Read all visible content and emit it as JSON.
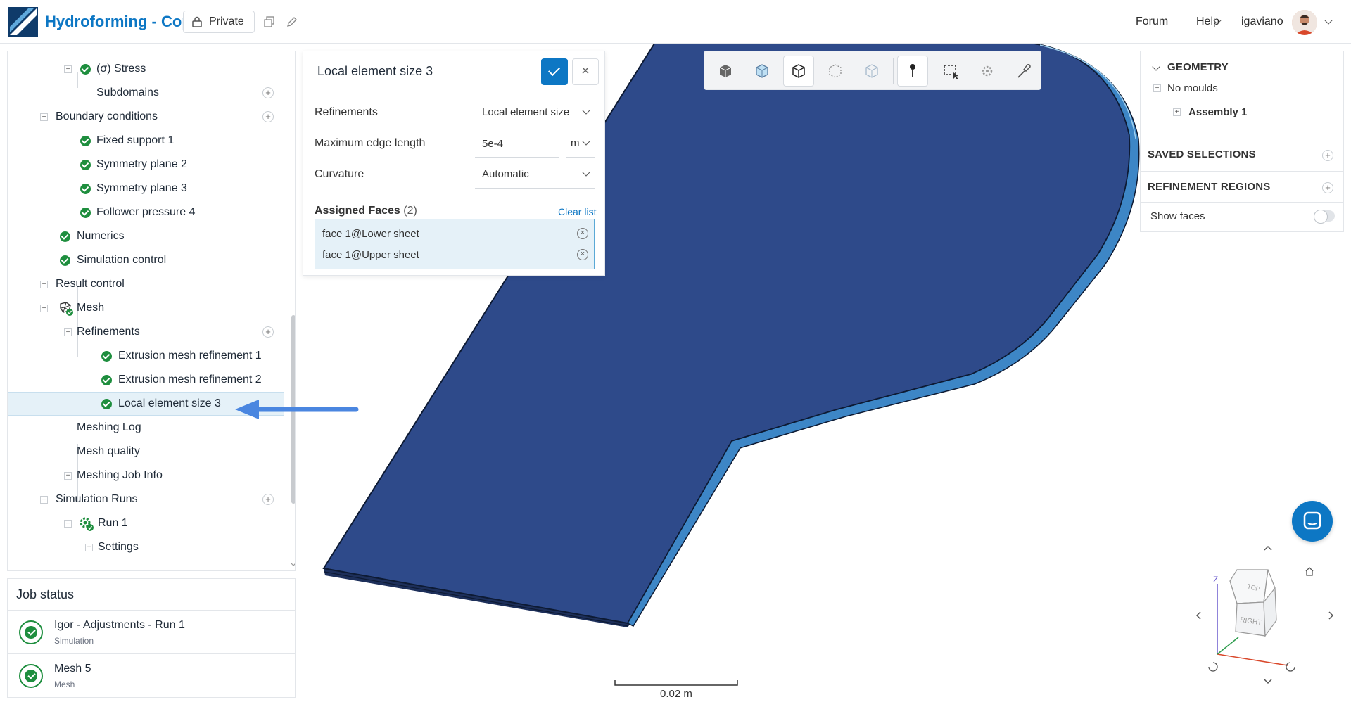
{
  "header": {
    "title": "Hydroforming - Copy",
    "private_label": "Private",
    "forum_label": "Forum",
    "help_label": "Help",
    "username": "igaviano"
  },
  "tree": {
    "items": [
      {
        "label": "(σ) Stress"
      },
      {
        "label": "Subdomains"
      },
      {
        "label": "Boundary conditions"
      },
      {
        "label": "Fixed support 1"
      },
      {
        "label": "Symmetry plane 2"
      },
      {
        "label": "Symmetry plane 3"
      },
      {
        "label": "Follower pressure 4"
      },
      {
        "label": "Numerics"
      },
      {
        "label": "Simulation control"
      },
      {
        "label": "Result control"
      },
      {
        "label": "Mesh"
      },
      {
        "label": "Refinements"
      },
      {
        "label": "Extrusion mesh refinement 1"
      },
      {
        "label": "Extrusion mesh refinement 2"
      },
      {
        "label": "Local element size 3"
      },
      {
        "label": "Meshing Log"
      },
      {
        "label": "Mesh quality"
      },
      {
        "label": "Meshing Job Info"
      },
      {
        "label": "Simulation Runs"
      },
      {
        "label": "Run 1"
      },
      {
        "label": "Settings"
      }
    ]
  },
  "job_status": {
    "title": "Job status",
    "jobs": [
      {
        "name": "Igor - Adjustments - Run 1",
        "type": "Simulation"
      },
      {
        "name": "Mesh 5",
        "type": "Mesh"
      }
    ]
  },
  "dialog": {
    "title": "Local element size 3",
    "refinements_label": "Refinements",
    "refinements_value": "Local element size",
    "max_edge_label": "Maximum edge length",
    "max_edge_value": "5e-4",
    "max_edge_unit": "m",
    "curvature_label": "Curvature",
    "curvature_value": "Automatic",
    "assigned_label": "Assigned Faces",
    "assigned_count": "(2)",
    "clear_label": "Clear list",
    "faces": [
      "face 1@Lower sheet",
      "face 1@Upper sheet"
    ]
  },
  "right_panel": {
    "geometry_label": "GEOMETRY",
    "no_moulds_label": "No moulds",
    "assembly_label": "Assembly 1",
    "saved_selections_label": "SAVED SELECTIONS",
    "refinement_regions_label": "REFINEMENT REGIONS",
    "show_faces_label": "Show faces"
  },
  "viewport": {
    "scale_label": "0.02 m",
    "cube_top": "TOP",
    "cube_right": "RIGHT",
    "axis_z": "Z"
  },
  "colors": {
    "accent": "#0d77c4",
    "success": "#1e8e3e",
    "model_body": "#2e4a8a",
    "model_edge": "#3d86c6",
    "arrow": "#4a86e0"
  }
}
